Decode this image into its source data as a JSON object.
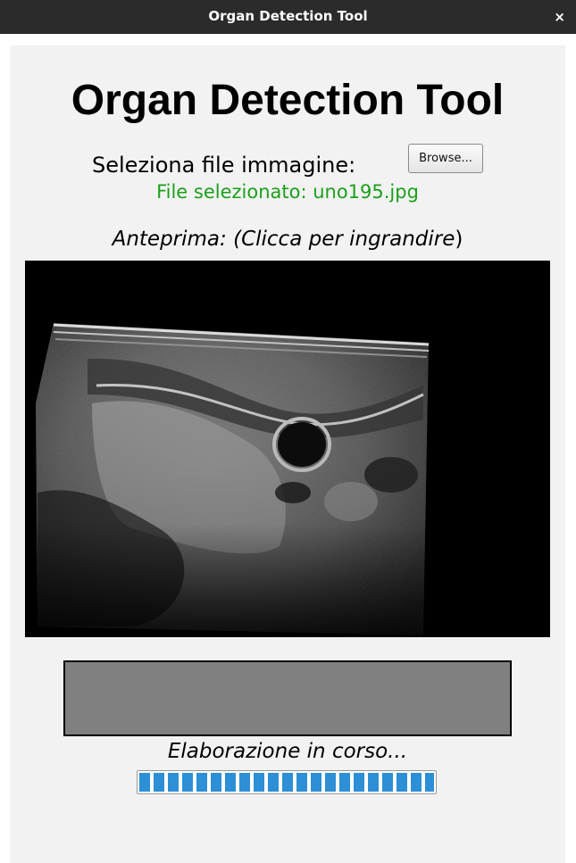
{
  "window": {
    "title": "Organ Detection Tool",
    "close_glyph": "×",
    "close_icon": "close-icon"
  },
  "app": {
    "title": "Organ Detection Tool",
    "file_select_label": "Seleziona file immagine:",
    "browse_button_label": "Browse...",
    "selected_file_text": "File selezionato: uno195.jpg",
    "preview_label_prefix": "Anteprima: (",
    "preview_label_hint": "Clicca per ingrandire",
    "preview_label_suffix": ")",
    "preview_image": "ultrasound-scan",
    "status_text": "Elaborazione in corso...",
    "progress": 1.0
  },
  "colors": {
    "selected_file": "#1aa01a",
    "progress_fill": "#2d8fd6",
    "result_box": "#808080",
    "titlebar": "#2b2b2b"
  }
}
